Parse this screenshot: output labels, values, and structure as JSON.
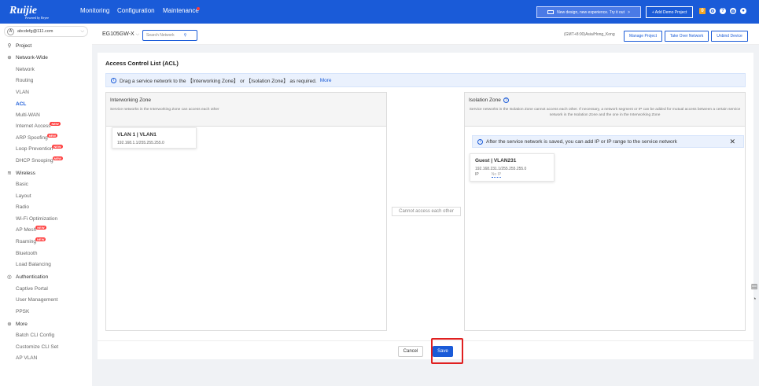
{
  "brand": {
    "name": "Ruijie",
    "tagline": "Powered by Reyee"
  },
  "topnav": [
    "Monitoring",
    "Configuration",
    "Maintenance"
  ],
  "top_right": {
    "banner": "New design, new experience. Try it out",
    "banner_arrow": ">",
    "demo_button": "+ Add Demo Project",
    "badge": "0"
  },
  "sidebar": {
    "user": "abcdefg@111.com",
    "project": "Project",
    "groups": [
      {
        "label": "Network-Wide",
        "items": [
          "Network",
          "Routing",
          "VLAN",
          "ACL",
          "Multi-WAN",
          "Internet Access",
          "ARP Spoofing",
          "Loop Prevention",
          "DHCP Snooping"
        ]
      },
      {
        "label": "Wireless",
        "items": [
          "Basic",
          "Layout",
          "Radio",
          "Wi-Fi Optimization",
          "AP Mesh",
          "Roaming",
          "Bluetooth",
          "Load Balancing"
        ]
      },
      {
        "label": "Authentication",
        "items": [
          "Captive Portal",
          "User Management",
          "PPSK"
        ]
      },
      {
        "label": "More",
        "items": [
          "Batch CLI Config",
          "Customize CLI Set",
          "AP VLAN"
        ]
      }
    ],
    "new_badge": "NEW"
  },
  "subbar": {
    "device": "EG105GW-X",
    "search_placeholder": "Search Network",
    "timezone": "(GMT+8:00)Asia/Hong_Kong",
    "buttons": [
      "Manage Project",
      "Take Over Network",
      "Unbind Device"
    ]
  },
  "page": {
    "title": "Access Control List (ACL)",
    "info_text": "Drag a service network to the 【Interworking Zone】 or 【Isolation Zone】 as required.",
    "info_link": "More",
    "interworking": {
      "title": "Interworking Zone",
      "desc": "Service networks in the Interworking Zone can access each other",
      "card": {
        "title": "VLAN 1 | VLAN1",
        "subnet": "192.168.1.1/255.255.255.0"
      }
    },
    "middle_label": "Cannot access each other",
    "isolation": {
      "title": "Isolation Zone",
      "desc": "Service networks in the Isolation Zone cannot access each other. If necessary, a network segment or IP can be added for mutual access between a certain service network in the Isolation Zone and the one in the Interworking Zone",
      "notice": "After the service network is saved, you can add IP or IP range to the service network",
      "card": {
        "title": "Guest | VLAN231",
        "subnet": "192.168.231.1/255.255.255.0",
        "ip_label": "IP",
        "ip_value": "No IP"
      }
    },
    "cancel": "Cancel",
    "save": "Save"
  }
}
